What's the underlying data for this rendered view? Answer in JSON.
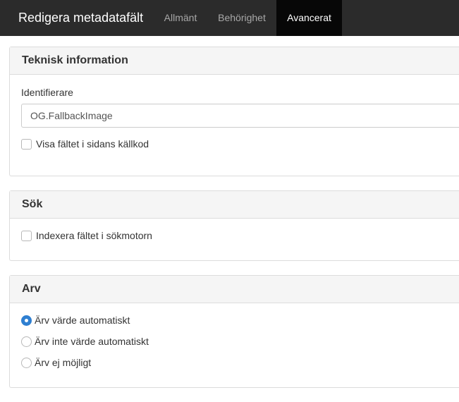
{
  "header": {
    "title": "Redigera metadatafält",
    "tabs": [
      {
        "label": "Allmänt",
        "active": false
      },
      {
        "label": "Behörighet",
        "active": false
      },
      {
        "label": "Avancerat",
        "active": true
      }
    ]
  },
  "panels": {
    "technical": {
      "title": "Teknisk information",
      "identifier_label": "Identifierare",
      "identifier_value": "OG.FallbackImage",
      "show_in_source_label": "Visa fältet i sidans källkod",
      "show_in_source_checked": false
    },
    "search": {
      "title": "Sök",
      "index_label": "Indexera fältet i sökmotorn",
      "index_checked": false
    },
    "inheritance": {
      "title": "Arv",
      "options": [
        {
          "label": "Ärv värde automatiskt",
          "selected": true
        },
        {
          "label": "Ärv inte värde automatiskt",
          "selected": false
        },
        {
          "label": "Ärv ej möjligt",
          "selected": false
        }
      ]
    }
  },
  "colors": {
    "topbar": "#2b2b2b",
    "active_tab": "#070707",
    "accent": "#2f7fd1",
    "panel_header": "#f5f5f5"
  }
}
